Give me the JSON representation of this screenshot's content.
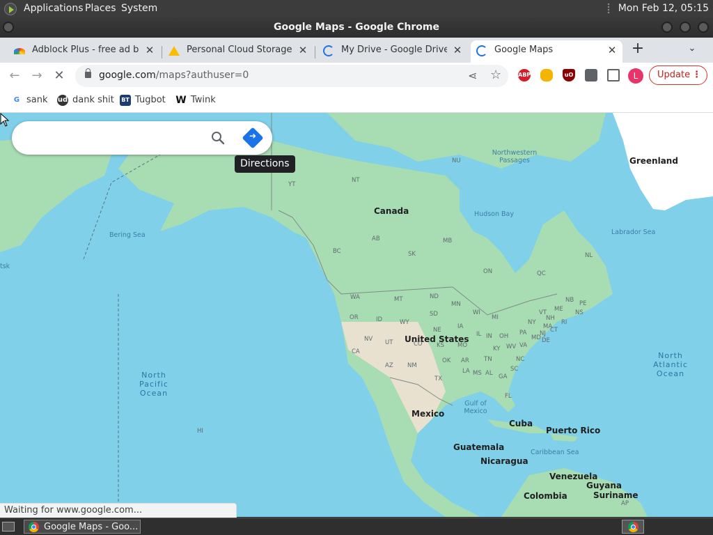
{
  "desktop_panel": {
    "menus": [
      "Applications",
      "Places",
      "System"
    ],
    "clock": "Mon Feb 12, 05:15"
  },
  "window": {
    "title": "Google Maps - Google Chrome"
  },
  "tabs": [
    {
      "label": "Adblock Plus - free ad blocker",
      "icon": "adblock-rainbow-icon",
      "active": false
    },
    {
      "label": "Personal Cloud Storage & File Sharing",
      "icon": "google-drive-icon",
      "active": false
    },
    {
      "label": "My Drive - Google Drive",
      "icon": "loading-spinner-icon",
      "active": false
    },
    {
      "label": "Google Maps",
      "icon": "loading-spinner-icon",
      "active": true
    }
  ],
  "tab_controls": {
    "new_tab": "+",
    "tab_list": "⌄"
  },
  "toolbar": {
    "url_domain": "google.com",
    "url_rest": "/maps?authuser=0",
    "profile_initial": "L",
    "update_label": "Update",
    "extensions": [
      "ABP",
      "uBlock Origin",
      "puzzle-extensions"
    ]
  },
  "bookmarks": [
    {
      "label": "sank",
      "icon": "google-g-icon"
    },
    {
      "label": "dank shit",
      "icon": "round-avatar-icon"
    },
    {
      "label": "Tugbot",
      "icon": "bt-icon"
    },
    {
      "label": "Twink",
      "icon": "w-icon"
    }
  ],
  "map": {
    "search_placeholder": "",
    "tooltip": "Directions",
    "labels": {
      "countries": [
        "Canada",
        "United States",
        "Mexico",
        "Greenland",
        "Cuba",
        "Puerto Rico",
        "Guatemala",
        "Nicaragua",
        "Venezuela",
        "Colombia",
        "Guyana",
        "Suriname"
      ],
      "regions": [
        "NU",
        "NT",
        "YT",
        "BC",
        "AB",
        "SK",
        "MB",
        "ON",
        "QC",
        "NL",
        "NB",
        "PE",
        "NS",
        "WA",
        "MT",
        "ND",
        "OR",
        "ID",
        "SD",
        "MN",
        "WI",
        "MI",
        "WY",
        "NE",
        "IA",
        "NY",
        "VT",
        "NH",
        "ME",
        "MA",
        "NV",
        "UT",
        "CO",
        "KS",
        "MO",
        "IL",
        "IN",
        "OH",
        "PA",
        "NJ",
        "CA",
        "AZ",
        "NM",
        "OK",
        "AR",
        "TN",
        "KY",
        "WV",
        "VA",
        "MD",
        "DE",
        "CT",
        "RI",
        "NC",
        "SC",
        "TX",
        "LA",
        "MS",
        "AL",
        "GA",
        "FL",
        "HI",
        "AP"
      ],
      "seas": [
        "Bering Sea",
        "Hudson Bay",
        "Northwestern Passages",
        "Labrador Sea",
        "Gulf of Mexico",
        "Caribbean Sea",
        "tsk"
      ],
      "oceans": [
        "North Pacific Ocean",
        "North Atlantic Ocean"
      ]
    }
  },
  "status": "Waiting for www.google.com...",
  "taskbar": {
    "task_label": "Google Maps - Goo..."
  },
  "colors": {
    "water": "#7fd0e8",
    "land": "#a8dcb3",
    "desert": "#e8e1cf",
    "accent": "#1a73e8",
    "ice": "#ffffff"
  }
}
